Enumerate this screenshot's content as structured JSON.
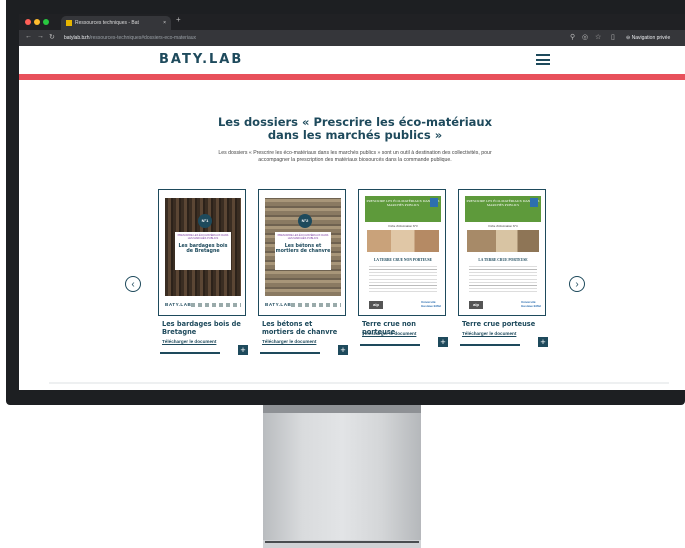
{
  "browser": {
    "tab_title": "Ressources techniques - Bat",
    "tab_close": "×",
    "new_tab": "+",
    "url_host": "batylab.bzh",
    "url_path": "/ressources-techniques#dossiers-eco-materiaux",
    "incognito_label": "Navigation privée",
    "icons": [
      "back-icon",
      "forward-icon",
      "reload-icon",
      "site-info-icon",
      "search-icon",
      "eye-off-icon",
      "star-icon",
      "side-panel-icon",
      "incognito-icon",
      "more-icon"
    ]
  },
  "site": {
    "logo": "BATY.LAB",
    "heading": "Les dossiers « Prescrire les éco-matériaux dans les marchés publics »",
    "intro": "Les dossiers « Prescrire les éco-matériaux dans les marchés publics » sont un outil à destination des collectivités, pour accompagner la prescription des matériaux biosourcés dans la commande publique.",
    "prev_arrow": "‹",
    "next_arrow": "›",
    "download_label": "Télécharger le document",
    "plus_label": "+",
    "cards": [
      {
        "title": "Les bardages bois de Bretagne",
        "cover_number": "N°1",
        "cover_kicker": "PRESCRIRE LES ÉCO-MATÉRIAUX DANS LES MARCHÉS PUBLICS",
        "cover_title": "Les bardages bois de Bretagne",
        "cover_footer": "BATY.LAB"
      },
      {
        "title": "Les bétons et mortiers de chanvre",
        "cover_number": "N°2",
        "cover_kicker": "PRESCRIRE LES ÉCO-MATÉRIAUX DANS LES MARCHÉS PUBLICS",
        "cover_title": "Les bétons et mortiers de chanvre",
        "cover_footer": "BATY.LAB"
      },
      {
        "title": "Terre crue non porteuse",
        "cover_header": "PRESCRIRE LES ÉCO-MATÉRIAUX DANS LES MARCHÉS PUBLICS",
        "cover_fiche": "Fiche d'information N°3",
        "cover_title": "LA TERRE CRUE NON PORTEUSE",
        "cover_logo": "alp",
        "cover_univ": "Université Gustave Eiffel"
      },
      {
        "title": "Terre crue porteuse",
        "cover_header": "PRESCRIRE LES ÉCO-MATÉRIAUX DANS LES MARCHÉS PUBLICS",
        "cover_fiche": "Fiche d'information N°4",
        "cover_title": "LA TERRE CRUE PORTEUSE",
        "cover_logo": "alp",
        "cover_univ": "Université Gustave Eiffel"
      }
    ]
  },
  "colors": {
    "brand": "#1e4a5c",
    "accent_red": "#e8505b",
    "cover_green": "#5e9a3b",
    "browser_dark": "#202124"
  }
}
